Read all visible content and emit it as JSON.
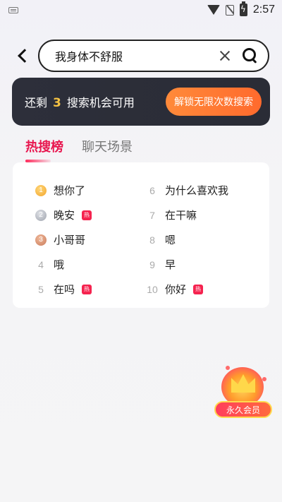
{
  "status_bar": {
    "time": "2:57"
  },
  "search": {
    "query": "我身体不舒服"
  },
  "quota": {
    "prefix": "还剩",
    "count": "3",
    "suffix": "搜索机会可用",
    "unlock_label": "解锁无限次数搜索"
  },
  "tabs": [
    {
      "label": "热搜榜",
      "active": true
    },
    {
      "label": "聊天场景",
      "active": false
    }
  ],
  "hot_list": {
    "left": [
      {
        "rank": "1",
        "text": "想你了",
        "hot": false
      },
      {
        "rank": "2",
        "text": "晚安",
        "hot": true
      },
      {
        "rank": "3",
        "text": "小哥哥",
        "hot": false
      },
      {
        "rank": "4",
        "text": "哦",
        "hot": false
      },
      {
        "rank": "5",
        "text": "在吗",
        "hot": true
      }
    ],
    "right": [
      {
        "rank": "6",
        "text": "为什么喜欢我",
        "hot": false
      },
      {
        "rank": "7",
        "text": "在干嘛",
        "hot": false
      },
      {
        "rank": "8",
        "text": "嗯",
        "hot": false
      },
      {
        "rank": "9",
        "text": "早",
        "hot": false
      },
      {
        "rank": "10",
        "text": "你好",
        "hot": true
      }
    ],
    "badge_label": "热"
  },
  "vip": {
    "label": "永久会员"
  },
  "colors": {
    "accent": "#e8174f",
    "banner_bg": "#2d2f3a",
    "quota_highlight": "#f6c343",
    "unlock_button": "#ff7a33"
  }
}
